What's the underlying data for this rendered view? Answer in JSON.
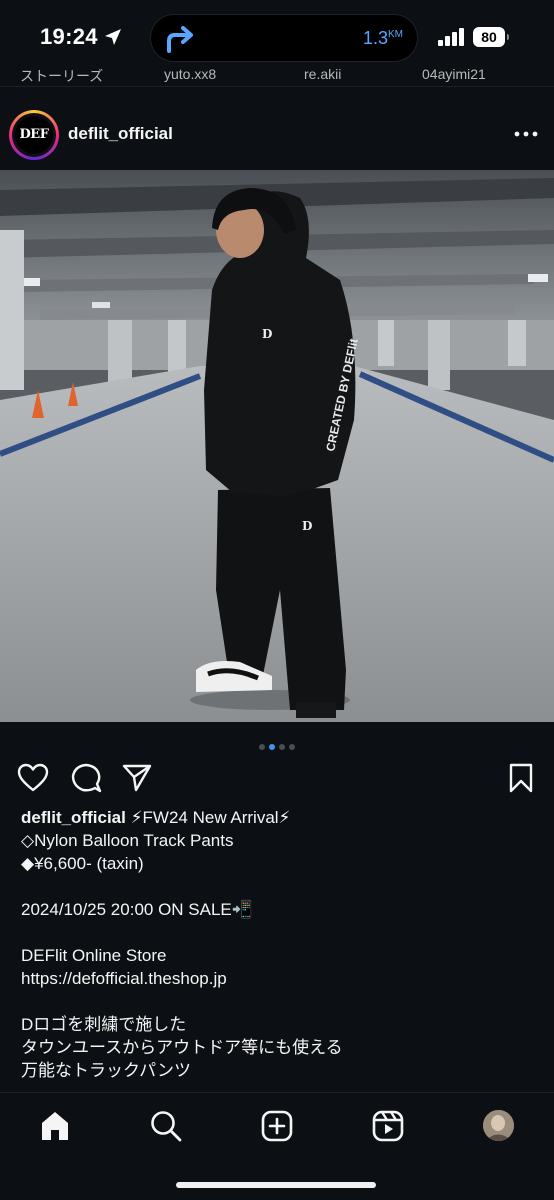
{
  "status_bar": {
    "time": "19:24",
    "navigation_distance": "1.3",
    "navigation_unit": "KM",
    "battery": "80",
    "icons": [
      "location-arrow-icon",
      "turn-right-arrow-icon",
      "signal-icon"
    ]
  },
  "stories": {
    "names": [
      "ストーリーズ",
      "yuto.xx8",
      "re.akii",
      "04ayimi21"
    ]
  },
  "post": {
    "username": "deflit_official",
    "avatar_label": "DEF",
    "carousel": {
      "count": 4,
      "active_index": 1
    },
    "caption": {
      "username": "deflit_official",
      "lines": [
        " ⚡FW24 New Arrival⚡",
        "◇Nylon Balloon Track Pants",
        "◆¥6,600- (taxin)",
        "",
        "2024/10/25 20:00 ON SALE📲",
        "",
        "DEFlit Online Store",
        "https://defofficial.theshop.jp",
        "",
        "Dロゴを刺繍で施した",
        "タウンユースからアウトドア等にも使える",
        "万能なトラックパンツ"
      ]
    },
    "photo_text": "CREATED BY DEFlit"
  },
  "actions": [
    "heart-icon",
    "comment-icon",
    "share-icon",
    "bookmark-icon"
  ],
  "tabbar": [
    "home-icon",
    "search-icon",
    "create-icon",
    "reels-icon",
    "profile-avatar"
  ],
  "colors": {
    "background": "#0c1014",
    "text": "#f5f5f5",
    "accent": "#3897f0",
    "nav_blue": "#5aa7ff"
  }
}
